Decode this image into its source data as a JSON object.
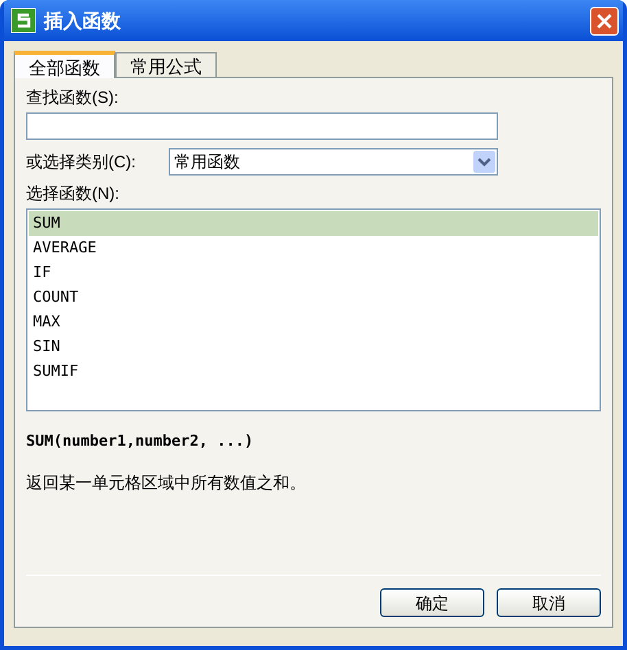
{
  "window": {
    "title": "插入函数"
  },
  "tabs": [
    {
      "label": "全部函数",
      "selected": true
    },
    {
      "label": "常用公式",
      "selected": false
    }
  ],
  "search": {
    "label": "查找函数(S):"
  },
  "category": {
    "label": "或选择类别(C):",
    "value": "常用函数"
  },
  "functions": {
    "label": "选择函数(N):",
    "items": [
      {
        "name": "SUM",
        "selected": true
      },
      {
        "name": "AVERAGE",
        "selected": false
      },
      {
        "name": "IF",
        "selected": false
      },
      {
        "name": "COUNT",
        "selected": false
      },
      {
        "name": "MAX",
        "selected": false
      },
      {
        "name": "SIN",
        "selected": false
      },
      {
        "name": "SUMIF",
        "selected": false
      }
    ]
  },
  "signature": "SUM(number1,number2, ...)",
  "description": "返回某一单元格区域中所有数值之和。",
  "buttons": [
    "确定",
    "取消"
  ]
}
